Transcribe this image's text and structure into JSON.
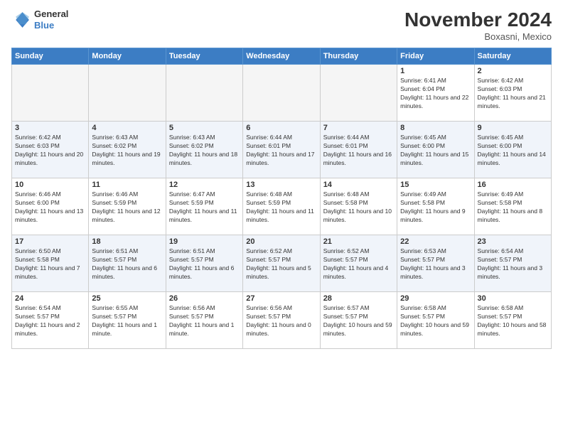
{
  "header": {
    "logo_line1": "General",
    "logo_line2": "Blue",
    "month": "November 2024",
    "location": "Boxasni, Mexico"
  },
  "days_of_week": [
    "Sunday",
    "Monday",
    "Tuesday",
    "Wednesday",
    "Thursday",
    "Friday",
    "Saturday"
  ],
  "weeks": [
    [
      {
        "day": "",
        "info": ""
      },
      {
        "day": "",
        "info": ""
      },
      {
        "day": "",
        "info": ""
      },
      {
        "day": "",
        "info": ""
      },
      {
        "day": "",
        "info": ""
      },
      {
        "day": "1",
        "info": "Sunrise: 6:41 AM\nSunset: 6:04 PM\nDaylight: 11 hours and 22 minutes."
      },
      {
        "day": "2",
        "info": "Sunrise: 6:42 AM\nSunset: 6:03 PM\nDaylight: 11 hours and 21 minutes."
      }
    ],
    [
      {
        "day": "3",
        "info": "Sunrise: 6:42 AM\nSunset: 6:03 PM\nDaylight: 11 hours and 20 minutes."
      },
      {
        "day": "4",
        "info": "Sunrise: 6:43 AM\nSunset: 6:02 PM\nDaylight: 11 hours and 19 minutes."
      },
      {
        "day": "5",
        "info": "Sunrise: 6:43 AM\nSunset: 6:02 PM\nDaylight: 11 hours and 18 minutes."
      },
      {
        "day": "6",
        "info": "Sunrise: 6:44 AM\nSunset: 6:01 PM\nDaylight: 11 hours and 17 minutes."
      },
      {
        "day": "7",
        "info": "Sunrise: 6:44 AM\nSunset: 6:01 PM\nDaylight: 11 hours and 16 minutes."
      },
      {
        "day": "8",
        "info": "Sunrise: 6:45 AM\nSunset: 6:00 PM\nDaylight: 11 hours and 15 minutes."
      },
      {
        "day": "9",
        "info": "Sunrise: 6:45 AM\nSunset: 6:00 PM\nDaylight: 11 hours and 14 minutes."
      }
    ],
    [
      {
        "day": "10",
        "info": "Sunrise: 6:46 AM\nSunset: 6:00 PM\nDaylight: 11 hours and 13 minutes."
      },
      {
        "day": "11",
        "info": "Sunrise: 6:46 AM\nSunset: 5:59 PM\nDaylight: 11 hours and 12 minutes."
      },
      {
        "day": "12",
        "info": "Sunrise: 6:47 AM\nSunset: 5:59 PM\nDaylight: 11 hours and 11 minutes."
      },
      {
        "day": "13",
        "info": "Sunrise: 6:48 AM\nSunset: 5:59 PM\nDaylight: 11 hours and 11 minutes."
      },
      {
        "day": "14",
        "info": "Sunrise: 6:48 AM\nSunset: 5:58 PM\nDaylight: 11 hours and 10 minutes."
      },
      {
        "day": "15",
        "info": "Sunrise: 6:49 AM\nSunset: 5:58 PM\nDaylight: 11 hours and 9 minutes."
      },
      {
        "day": "16",
        "info": "Sunrise: 6:49 AM\nSunset: 5:58 PM\nDaylight: 11 hours and 8 minutes."
      }
    ],
    [
      {
        "day": "17",
        "info": "Sunrise: 6:50 AM\nSunset: 5:58 PM\nDaylight: 11 hours and 7 minutes."
      },
      {
        "day": "18",
        "info": "Sunrise: 6:51 AM\nSunset: 5:57 PM\nDaylight: 11 hours and 6 minutes."
      },
      {
        "day": "19",
        "info": "Sunrise: 6:51 AM\nSunset: 5:57 PM\nDaylight: 11 hours and 6 minutes."
      },
      {
        "day": "20",
        "info": "Sunrise: 6:52 AM\nSunset: 5:57 PM\nDaylight: 11 hours and 5 minutes."
      },
      {
        "day": "21",
        "info": "Sunrise: 6:52 AM\nSunset: 5:57 PM\nDaylight: 11 hours and 4 minutes."
      },
      {
        "day": "22",
        "info": "Sunrise: 6:53 AM\nSunset: 5:57 PM\nDaylight: 11 hours and 3 minutes."
      },
      {
        "day": "23",
        "info": "Sunrise: 6:54 AM\nSunset: 5:57 PM\nDaylight: 11 hours and 3 minutes."
      }
    ],
    [
      {
        "day": "24",
        "info": "Sunrise: 6:54 AM\nSunset: 5:57 PM\nDaylight: 11 hours and 2 minutes."
      },
      {
        "day": "25",
        "info": "Sunrise: 6:55 AM\nSunset: 5:57 PM\nDaylight: 11 hours and 1 minute."
      },
      {
        "day": "26",
        "info": "Sunrise: 6:56 AM\nSunset: 5:57 PM\nDaylight: 11 hours and 1 minute."
      },
      {
        "day": "27",
        "info": "Sunrise: 6:56 AM\nSunset: 5:57 PM\nDaylight: 11 hours and 0 minutes."
      },
      {
        "day": "28",
        "info": "Sunrise: 6:57 AM\nSunset: 5:57 PM\nDaylight: 10 hours and 59 minutes."
      },
      {
        "day": "29",
        "info": "Sunrise: 6:58 AM\nSunset: 5:57 PM\nDaylight: 10 hours and 59 minutes."
      },
      {
        "day": "30",
        "info": "Sunrise: 6:58 AM\nSunset: 5:57 PM\nDaylight: 10 hours and 58 minutes."
      }
    ]
  ]
}
